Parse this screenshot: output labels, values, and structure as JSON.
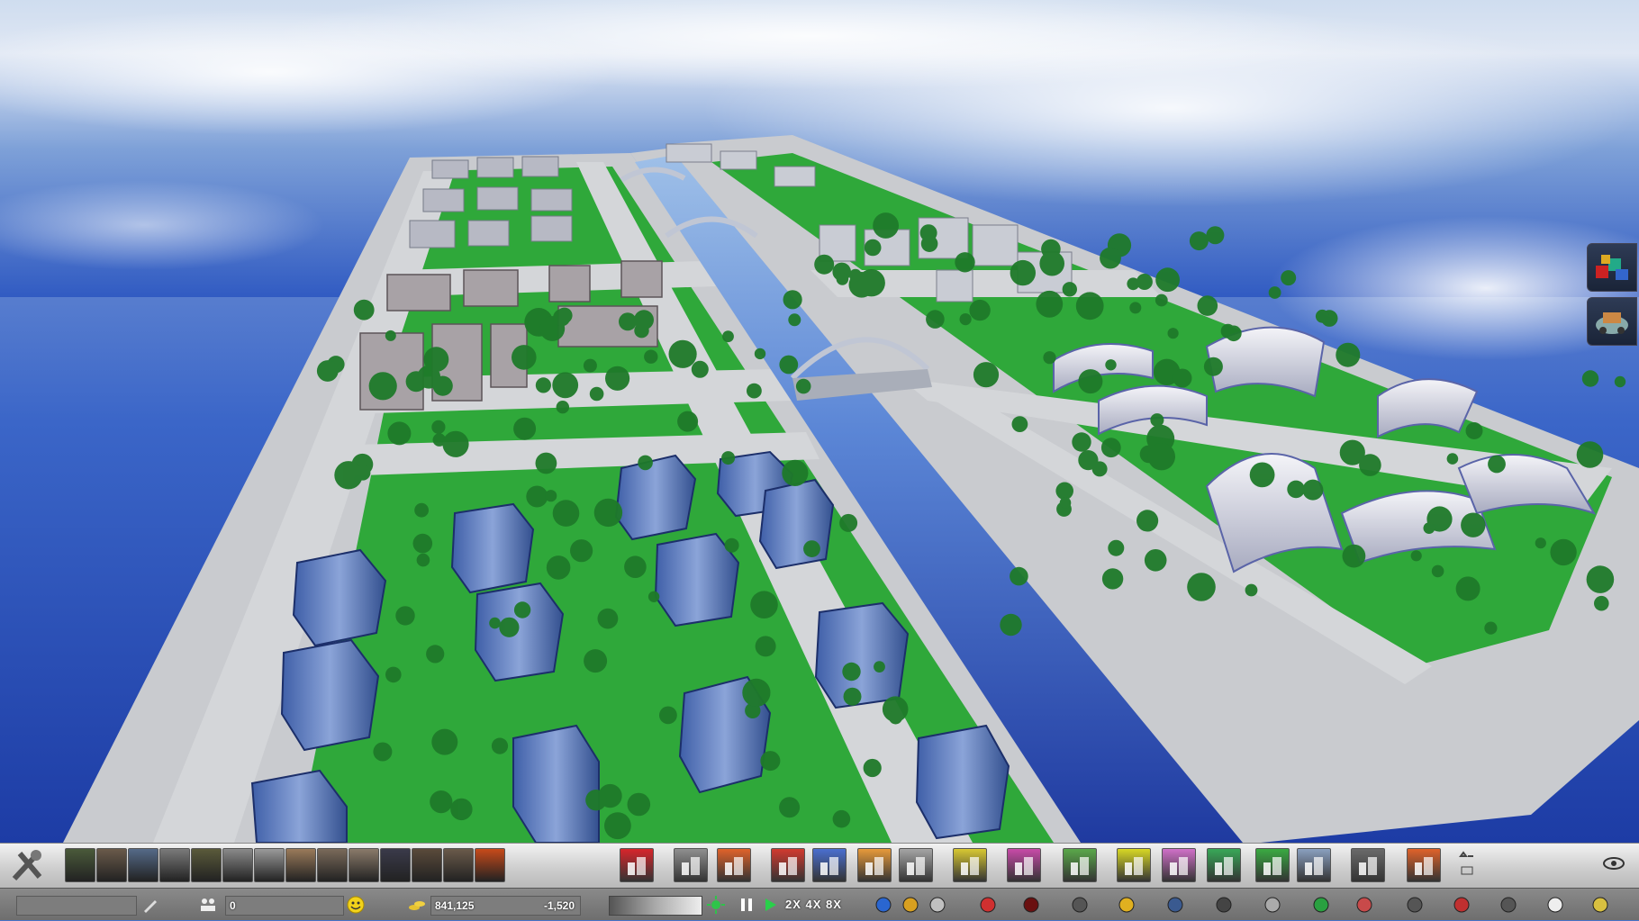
{
  "scene": {
    "name": "island-city-view",
    "colors": {
      "water": "#2f55b8",
      "ground": "#cfd1d4",
      "grass": "#2fa83a",
      "sky": "#c9dbee"
    }
  },
  "sidebar": {
    "items": [
      {
        "name": "resources-panel-button",
        "icon": "crates-icon"
      },
      {
        "name": "transport-panel-button",
        "icon": "vehicle-icon"
      }
    ]
  },
  "toolbar": {
    "tool_groups": [
      {
        "name": "build-tools-icon"
      },
      {
        "name": "nature-tool"
      },
      {
        "name": "mining-tool"
      },
      {
        "name": "stats-tool"
      },
      {
        "name": "power-tool"
      },
      {
        "name": "waste-tool"
      },
      {
        "name": "lab-tool"
      },
      {
        "name": "factory-tool"
      },
      {
        "name": "warehouse-tool"
      },
      {
        "name": "crafting-tool"
      },
      {
        "name": "paper-tool"
      },
      {
        "name": "vehicle-tool"
      },
      {
        "name": "materials-tool"
      },
      {
        "name": "goods-tool"
      },
      {
        "name": "fire-tool"
      }
    ],
    "zones": [
      {
        "name": "health",
        "color": "#d8252b"
      },
      {
        "name": "road",
        "color": "#8f8f8f"
      },
      {
        "name": "transit",
        "color": "#e0622a"
      },
      {
        "name": "industry",
        "color": "#d23a2f"
      },
      {
        "name": "residential",
        "color": "#4a6fd0"
      },
      {
        "name": "commercial",
        "color": "#e89a3a"
      },
      {
        "name": "office",
        "color": "#a5a5a5"
      },
      {
        "name": "education",
        "color": "#d8c832"
      },
      {
        "name": "leisure",
        "color": "#c84aa8"
      },
      {
        "name": "farm",
        "color": "#5aa84a"
      },
      {
        "name": "civic",
        "color": "#d8d824"
      },
      {
        "name": "culture",
        "color": "#d070c8"
      },
      {
        "name": "park",
        "color": "#38a858"
      },
      {
        "name": "greenhouse",
        "color": "#3aaa42"
      },
      {
        "name": "skyline",
        "color": "#8aa0c0"
      },
      {
        "name": "storage",
        "color": "#6a6a6a"
      },
      {
        "name": "demolish",
        "color": "#e0622a"
      }
    ]
  },
  "status": {
    "population": "0",
    "money": "841,125",
    "income": "-1,520",
    "speeds": "2X 4X 8X"
  }
}
